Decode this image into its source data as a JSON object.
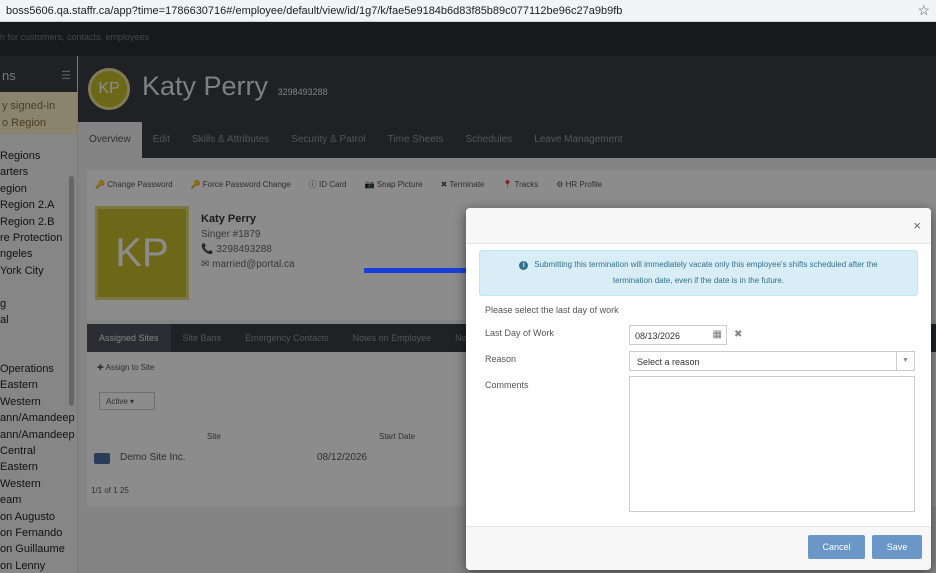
{
  "browser": {
    "url": "boss5606.qa.staffr.ca/app?time=1786630716#/employee/default/view/id/1g7/k/fae5e9184b6d83f85b89c077112be96c27a9b9fb",
    "bookmark_icon": "star-icon"
  },
  "app": {
    "search_placeholder": "h for customers, contacts, employees",
    "sidebar": {
      "title": "ns",
      "notice": "y signed-in\no Region",
      "items": [
        "Regions",
        "arters",
        "egion",
        "Region 2.A",
        "Region 2.B",
        "re Protection",
        "ngeles",
        "York City",
        "",
        "g",
        "al",
        "",
        "",
        "Operations",
        "Eastern",
        "Western",
        "ann/Amandeep",
        "ann/Amandeep",
        "Central",
        "Eastern",
        "Western",
        "eam",
        "on Augusto",
        "on Fernando",
        "on Guillaume",
        "on Lenny"
      ]
    },
    "profile": {
      "initials": "KP",
      "name": "Katy Perry",
      "phone_small": "3298493288"
    },
    "tabs": [
      "Overview",
      "Edit",
      "Skills & Attributes",
      "Security & Patrol",
      "Time Sheets",
      "Schedules",
      "Leave Management"
    ],
    "actions": [
      "Change Password",
      "Force Password Change",
      "ID Card",
      "Snap Picture",
      "Terminate",
      "Tracks",
      "HR Profile"
    ],
    "card": {
      "name": "Katy Perry",
      "title": "Singer #1879",
      "phone": "3298493288",
      "email": "married@portal.ca"
    },
    "subtabs": [
      "Assigned Sites",
      "Site Bans",
      "Emergency Contacts",
      "Notes on Employee",
      "No"
    ],
    "sites": {
      "assign_label": "Assign to Site",
      "filter": "Active",
      "col_site": "Site",
      "col_start": "Start Date",
      "row_site": "Demo Site Inc.",
      "row_date": "08/12/2026",
      "pager": "1/1 of 1   25"
    }
  },
  "modal": {
    "close_label": "×",
    "alert_line1": "Submitting this termination will immediately vacate only this employee's shifts scheduled after the",
    "alert_line2": "termination date, even if the date is in the future.",
    "prompt": "Please select the last day of work",
    "last_day_label": "Last Day of Work",
    "last_day_value": "08/13/2026",
    "reason_label": "Reason",
    "reason_placeholder": "Select a reason",
    "comments_label": "Comments",
    "cancel_label": "Cancel",
    "save_label": "Save"
  },
  "colors": {
    "alert_bg": "#d9edf7",
    "arrow": "#1a3fd8",
    "button": "#6a97c8",
    "avatar": "#c6be2c"
  }
}
